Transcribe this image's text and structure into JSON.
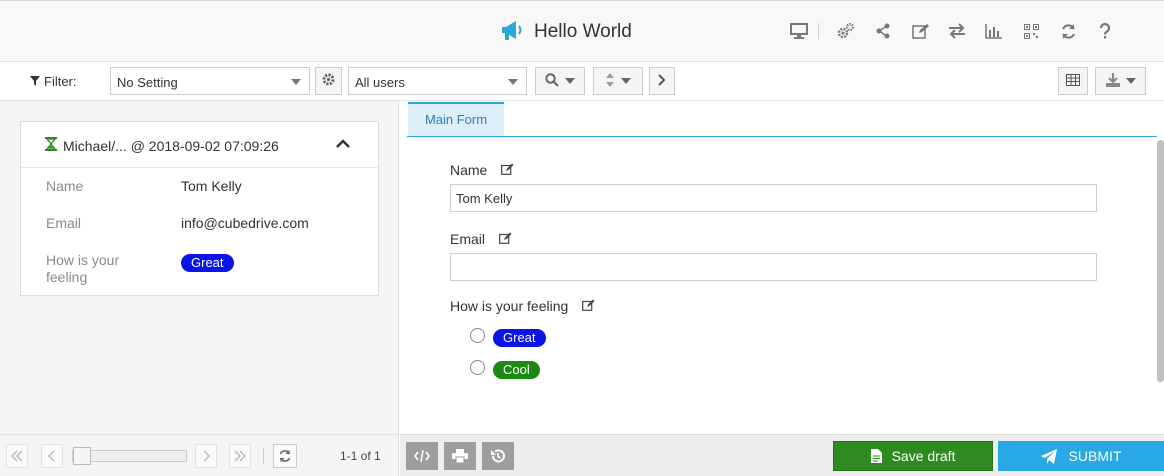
{
  "header": {
    "title": "Hello World",
    "icons": [
      "monitor-icon",
      "gears-icon",
      "share-icon",
      "edit-icon",
      "exchange-icon",
      "bar-chart-icon",
      "qrcode-icon",
      "refresh-icon",
      "question-icon"
    ]
  },
  "filterbar": {
    "filter_label": "Filter:",
    "setting_value": "No Setting",
    "users_value": "All users"
  },
  "record": {
    "header_text": "Michael/... @ 2018-09-02 07:09:26",
    "fields": [
      {
        "label": "Name",
        "value": "Tom Kelly"
      },
      {
        "label": "Email",
        "value": "info@cubedrive.com"
      },
      {
        "label": "How is your feeling",
        "value": "Great"
      }
    ]
  },
  "tabs": [
    {
      "label": "Main Form"
    }
  ],
  "form": {
    "name_label": "Name",
    "name_value": "Tom Kelly",
    "email_label": "Email",
    "email_value": "",
    "feeling_label": "How is your feeling",
    "options": [
      {
        "label": "Great",
        "color": "#0a14e6"
      },
      {
        "label": "Cool",
        "color": "#1b8a12"
      }
    ]
  },
  "pagination": {
    "text": "1-1 of 1"
  },
  "actions": {
    "save_draft": "Save draft",
    "submit": "SUBMIT"
  },
  "colors": {
    "accent": "#29a8d9",
    "save": "#2e8b1f",
    "submit": "#29a8e6",
    "great": "#0a14e6",
    "cool": "#1b8a12"
  }
}
